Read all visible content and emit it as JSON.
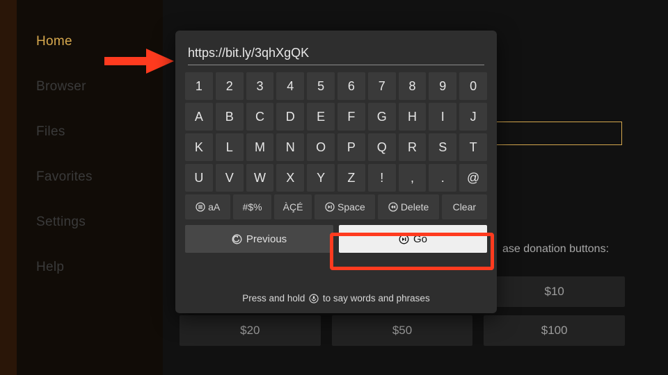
{
  "sidebar": {
    "items": [
      {
        "label": "Home",
        "active": true
      },
      {
        "label": "Browser",
        "active": false
      },
      {
        "label": "Files",
        "active": false
      },
      {
        "label": "Favorites",
        "active": false
      },
      {
        "label": "Settings",
        "active": false
      },
      {
        "label": "Help",
        "active": false
      }
    ]
  },
  "keyboard": {
    "input_value": "https://bit.ly/3qhXgQK",
    "rows": {
      "digits": [
        "1",
        "2",
        "3",
        "4",
        "5",
        "6",
        "7",
        "8",
        "9",
        "0"
      ],
      "letters1": [
        "A",
        "B",
        "C",
        "D",
        "E",
        "F",
        "G",
        "H",
        "I",
        "J"
      ],
      "letters2": [
        "K",
        "L",
        "M",
        "N",
        "O",
        "P",
        "Q",
        "R",
        "S",
        "T"
      ],
      "letters3": [
        "U",
        "V",
        "W",
        "X",
        "Y",
        "Z",
        "!",
        ",",
        ".",
        "@"
      ]
    },
    "fn": {
      "shift": "aA",
      "symbols": "#$%",
      "accents": "ÀÇÉ",
      "space": "Space",
      "delete": "Delete",
      "clear": "Clear"
    },
    "nav": {
      "previous": "Previous",
      "go": "Go"
    },
    "hint_prefix": "Press and hold ",
    "hint_suffix": " to say words and phrases"
  },
  "background": {
    "donation_label": "ase donation buttons:",
    "donations_row1": [
      "",
      "",
      "$10"
    ],
    "donations_row2": [
      "$20",
      "$50",
      "$100"
    ]
  },
  "annotation": {
    "arrow_color": "#ff3b1f",
    "go_highlight_color": "#ff3b1f"
  }
}
